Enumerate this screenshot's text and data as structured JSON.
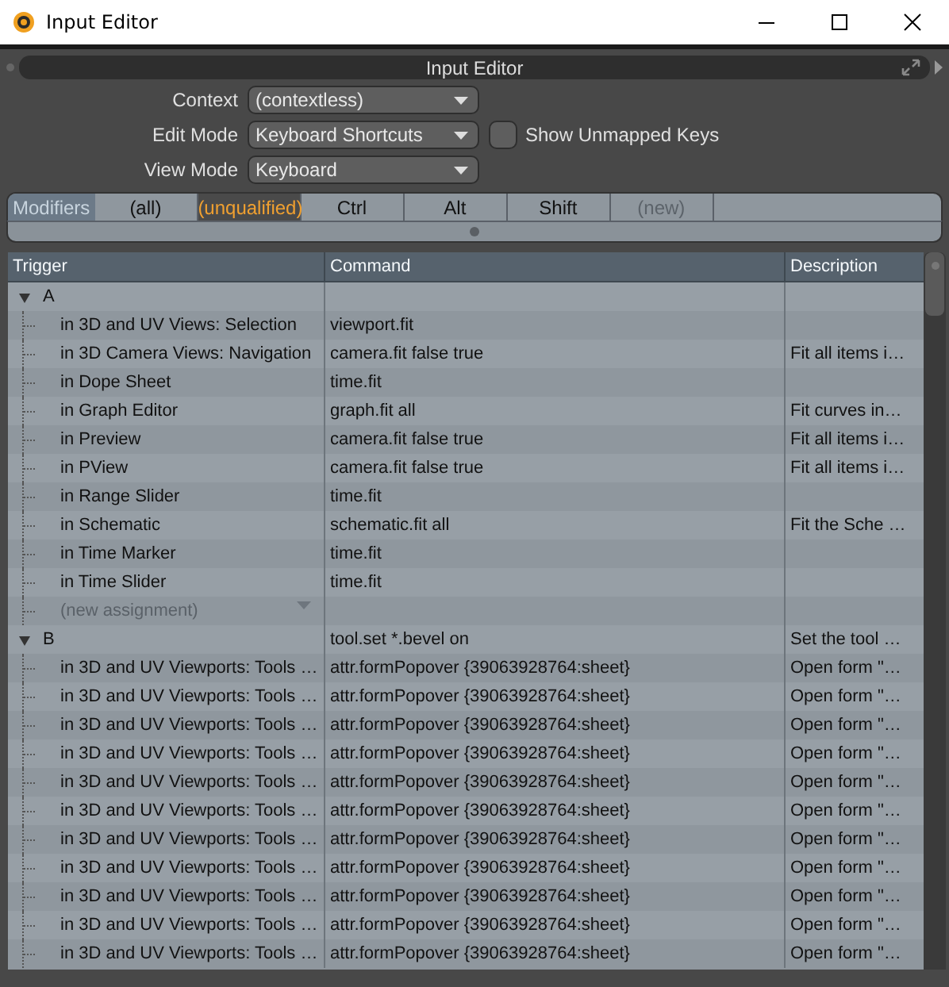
{
  "window": {
    "title": "Input Editor"
  },
  "panel": {
    "title": "Input Editor"
  },
  "form": [
    {
      "label": "Context",
      "value": "(contextless)"
    },
    {
      "label": "Edit Mode",
      "value": "Keyboard Shortcuts"
    },
    {
      "label": "View Mode",
      "value": "Keyboard"
    }
  ],
  "show_unmapped": {
    "label": "Show Unmapped Keys",
    "checked": false
  },
  "modifiers": {
    "label": "Modifiers",
    "tabs": [
      {
        "label": "(all)",
        "selected": false,
        "disabled": false
      },
      {
        "label": "(unqualified)",
        "selected": true,
        "disabled": false
      },
      {
        "label": "Ctrl",
        "selected": false,
        "disabled": false
      },
      {
        "label": "Alt",
        "selected": false,
        "disabled": false
      },
      {
        "label": "Shift",
        "selected": false,
        "disabled": false
      },
      {
        "label": "(new)",
        "selected": false,
        "disabled": true
      }
    ]
  },
  "table": {
    "columns": [
      "Trigger",
      "Command",
      "Description"
    ],
    "groups": [
      {
        "key": "A",
        "expanded": true,
        "children": [
          {
            "kind": "binding",
            "trigger": "in 3D and UV Views: Selection",
            "command": "viewport.fit"
          },
          {
            "kind": "binding",
            "trigger": "in 3D Camera Views: Navigation",
            "command": "camera.fit false true",
            "description": "Fit all items i…"
          },
          {
            "kind": "binding",
            "trigger": "in Dope Sheet",
            "command": "time.fit"
          },
          {
            "kind": "binding",
            "trigger": "in Graph Editor",
            "command": "graph.fit all",
            "description": "Fit curves in…"
          },
          {
            "kind": "binding",
            "trigger": "in Preview",
            "command": "camera.fit false true",
            "description": "Fit all items i…"
          },
          {
            "kind": "binding",
            "trigger": "in PView",
            "command": "camera.fit false true",
            "description": "Fit all items i…"
          },
          {
            "kind": "binding",
            "trigger": "in Range Slider",
            "command": "time.fit"
          },
          {
            "kind": "binding",
            "trigger": "in Schematic",
            "command": "schematic.fit all",
            "description": "Fit the Sche …"
          },
          {
            "kind": "binding",
            "trigger": "in Time Marker",
            "command": "time.fit"
          },
          {
            "kind": "binding",
            "trigger": "in Time Slider",
            "command": "time.fit"
          },
          {
            "kind": "new",
            "trigger": "(new assignment)"
          }
        ]
      },
      {
        "key": "B",
        "expanded": true,
        "command": "tool.set *.bevel on",
        "description": "Set the tool …",
        "children": [
          {
            "kind": "binding",
            "trigger": "in 3D and UV Viewports: Tools …",
            "command": "attr.formPopover {39063928764:sheet}",
            "description": "Open form \"…"
          },
          {
            "kind": "binding",
            "trigger": "in 3D and UV Viewports: Tools …",
            "command": "attr.formPopover {39063928764:sheet}",
            "description": "Open form \"…"
          },
          {
            "kind": "binding",
            "trigger": "in 3D and UV Viewports: Tools …",
            "command": "attr.formPopover {39063928764:sheet}",
            "description": "Open form \"…"
          },
          {
            "kind": "binding",
            "trigger": "in 3D and UV Viewports: Tools …",
            "command": "attr.formPopover {39063928764:sheet}",
            "description": "Open form \"…"
          },
          {
            "kind": "binding",
            "trigger": "in 3D and UV Viewports: Tools …",
            "command": "attr.formPopover {39063928764:sheet}",
            "description": "Open form \"…"
          },
          {
            "kind": "binding",
            "trigger": "in 3D and UV Viewports: Tools …",
            "command": "attr.formPopover {39063928764:sheet}",
            "description": "Open form \"…"
          },
          {
            "kind": "binding",
            "trigger": "in 3D and UV Viewports: Tools …",
            "command": "attr.formPopover {39063928764:sheet}",
            "description": "Open form \"…"
          },
          {
            "kind": "binding",
            "trigger": "in 3D and UV Viewports: Tools …",
            "command": "attr.formPopover {39063928764:sheet}",
            "description": "Open form \"…"
          },
          {
            "kind": "binding",
            "trigger": "in 3D and UV Viewports: Tools …",
            "command": "attr.formPopover {39063928764:sheet}",
            "description": "Open form \"…"
          },
          {
            "kind": "binding",
            "trigger": "in 3D and UV Viewports: Tools …",
            "command": "attr.formPopover {39063928764:sheet}",
            "description": "Open form \"…"
          },
          {
            "kind": "binding",
            "trigger": "in 3D and UV Viewports: Tools …",
            "command": "attr.formPopover {39063928764:sheet}",
            "description": "Open form \"…"
          }
        ]
      }
    ]
  }
}
